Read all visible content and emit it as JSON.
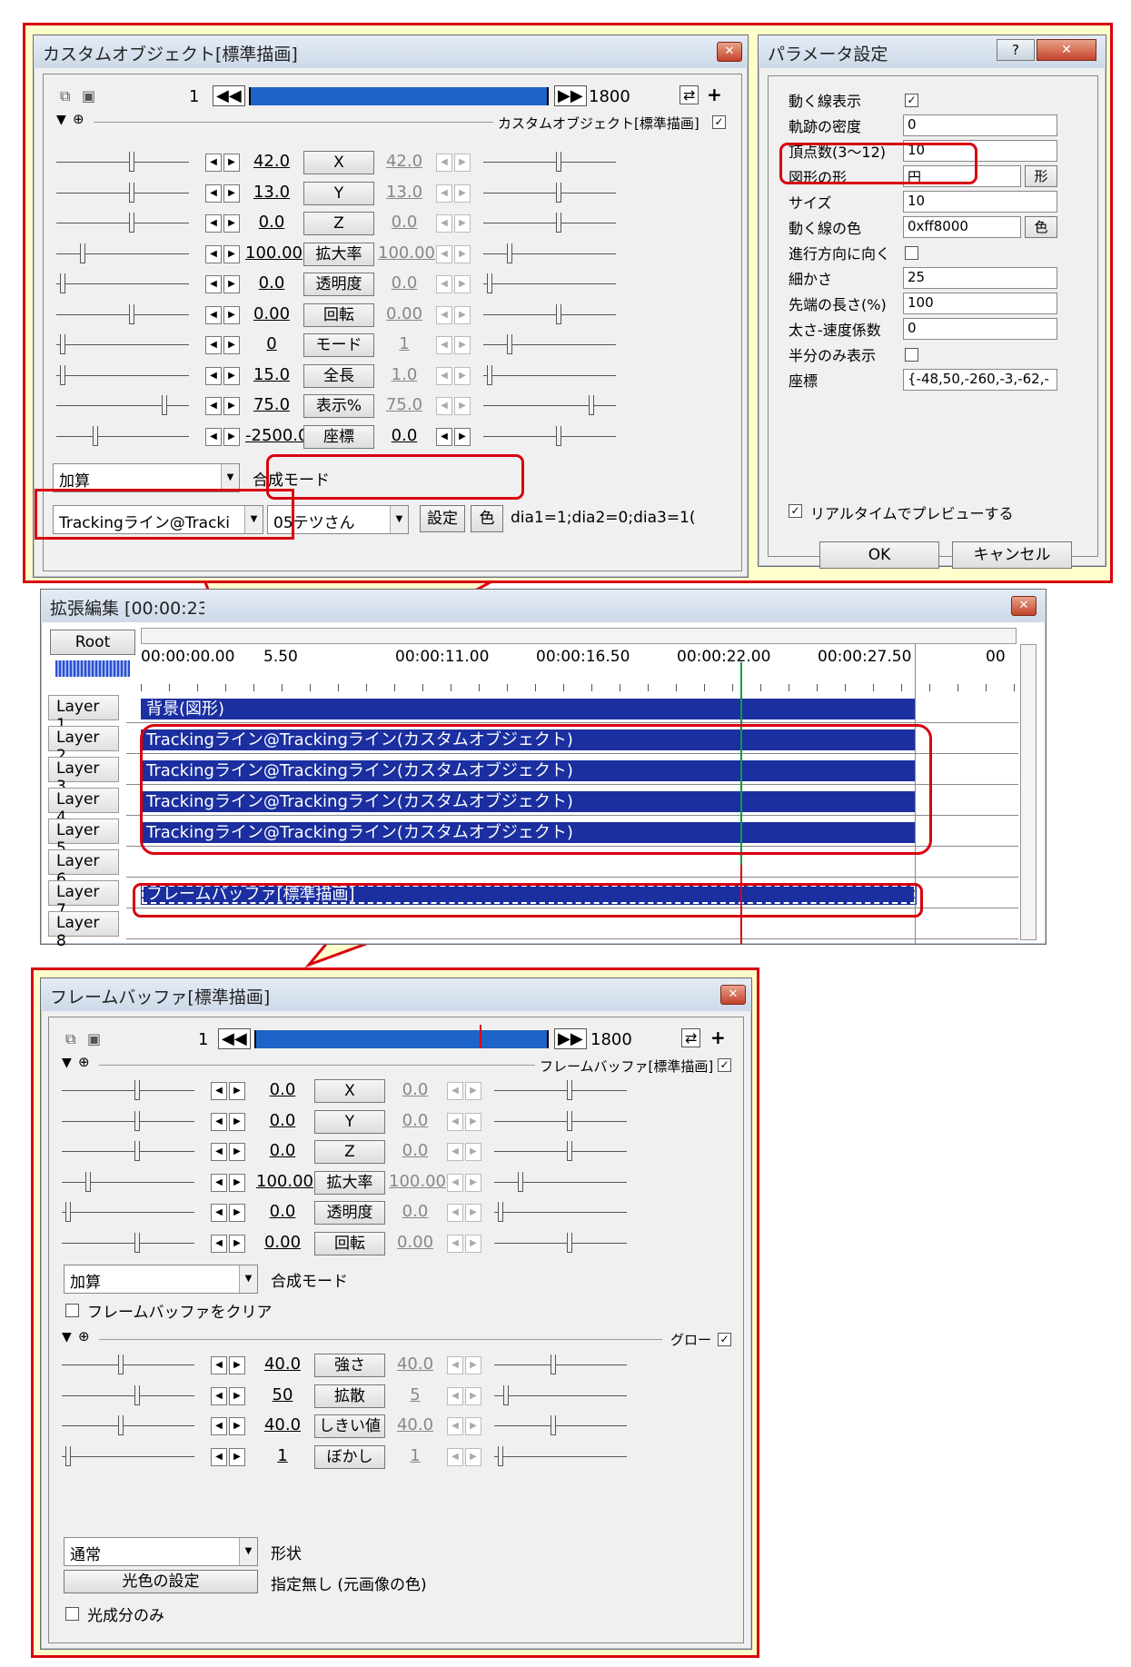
{
  "custom_object": {
    "title": "カスタムオブジェクト[標準描画]",
    "frame_current": "1",
    "frame_total": "1800",
    "plus": "+",
    "group_label": "カスタムオブジェクト[標準描画]",
    "group_checked": "✓",
    "params": [
      {
        "name": "X",
        "start": "42.0",
        "end": "42.0"
      },
      {
        "name": "Y",
        "start": "13.0",
        "end": "13.0"
      },
      {
        "name": "Z",
        "start": "0.0",
        "end": "0.0"
      },
      {
        "name": "拡大率",
        "start": "100.00",
        "end": "100.00"
      },
      {
        "name": "透明度",
        "start": "0.0",
        "end": "0.0"
      },
      {
        "name": "回転",
        "start": "0.00",
        "end": "0.00"
      },
      {
        "name": "モード",
        "start": "0",
        "end": "1"
      },
      {
        "name": "全長",
        "start": "15.0",
        "end": "1.0"
      },
      {
        "name": "表示%",
        "start": "75.0",
        "end": "75.0"
      },
      {
        "name": "座標",
        "start": "-2500.0",
        "end": "0.0"
      }
    ],
    "blend_mode": "加算",
    "blend_label": "合成モード",
    "script_select": "Trackingライン@Tracki",
    "author_select": "05テツさん",
    "settings_button": "設定",
    "color_button": "色",
    "param_text": "dia1=1;dia2=0;dia3=1("
  },
  "param_dialog": {
    "title": "パラメータ設定",
    "help": "?",
    "close": "✕",
    "rows": [
      {
        "label": "動く線表示",
        "type": "check",
        "value": "✓"
      },
      {
        "label": "軌跡の密度",
        "type": "input",
        "value": "0"
      },
      {
        "label": "頂点数(3〜12)",
        "type": "input",
        "value": "10"
      },
      {
        "label": "図形の形",
        "type": "input-btn",
        "value": "円",
        "btn": "形"
      },
      {
        "label": "サイズ",
        "type": "input",
        "value": "10"
      },
      {
        "label": "動く線の色",
        "type": "input-btn",
        "value": "0xff8000",
        "btn": "色"
      },
      {
        "label": "進行方向に向く",
        "type": "check",
        "value": ""
      },
      {
        "label": "細かさ",
        "type": "input",
        "value": "25"
      },
      {
        "label": "先端の長さ(%)",
        "type": "input",
        "value": "100"
      },
      {
        "label": "太さ-速度係数",
        "type": "input",
        "value": "0"
      },
      {
        "label": "半分のみ表示",
        "type": "check",
        "value": ""
      },
      {
        "label": "座標",
        "type": "input",
        "value": "{-48,50,-260,-3,-62,-"
      }
    ],
    "realtime_check": "✓",
    "realtime_label": "リアルタイムでプレビューする",
    "ok": "OK",
    "cancel": "キャンセル"
  },
  "timeline": {
    "title": "拡張編集 [00:00:23",
    "root": "Root",
    "ticks": [
      "00:00:00.00",
      "5.50",
      "00:00:11.00",
      "00:00:16.50",
      "00:00:22.00",
      "00:00:27.50",
      "00"
    ],
    "layers": [
      "Layer 1",
      "Layer 2",
      "Layer 3",
      "Layer 4",
      "Layer 5",
      "Layer 6",
      "Layer 7",
      "Layer 8"
    ],
    "clips": [
      {
        "layer": 0,
        "label": "背景(図形)"
      },
      {
        "layer": 1,
        "label": "Trackingライン@Trackingライン(カスタムオブジェクト)"
      },
      {
        "layer": 2,
        "label": "Trackingライン@Trackingライン(カスタムオブジェクト)"
      },
      {
        "layer": 3,
        "label": "Trackingライン@Trackingライン(カスタムオブジェクト)"
      },
      {
        "layer": 4,
        "label": "Trackingライン@Trackingライン(カスタムオブジェクト)"
      },
      {
        "layer": 6,
        "label": "フレームバッファ[標準描画]"
      }
    ],
    "clip_color": "#1b2fa0"
  },
  "frame_buffer": {
    "title": "フレームバッファ[標準描画]",
    "frame_current": "1",
    "frame_total": "1800",
    "plus": "+",
    "group_label": "フレームバッファ[標準描画]",
    "group_checked": "✓",
    "params": [
      {
        "name": "X",
        "start": "0.0",
        "end": "0.0"
      },
      {
        "name": "Y",
        "start": "0.0",
        "end": "0.0"
      },
      {
        "name": "Z",
        "start": "0.0",
        "end": "0.0"
      },
      {
        "name": "拡大率",
        "start": "100.00",
        "end": "100.00"
      },
      {
        "name": "透明度",
        "start": "0.0",
        "end": "0.0"
      },
      {
        "name": "回転",
        "start": "0.00",
        "end": "0.00"
      }
    ],
    "blend_mode": "加算",
    "blend_label": "合成モード",
    "clear_label": "フレームバッファをクリア",
    "glow_label": "グロー",
    "glow_checked": "✓",
    "glow_params": [
      {
        "name": "強さ",
        "start": "40.0",
        "end": "40.0"
      },
      {
        "name": "拡散",
        "start": "50",
        "end": "5"
      },
      {
        "name": "しきい値",
        "start": "40.0",
        "end": "40.0"
      },
      {
        "name": "ぼかし",
        "start": "1",
        "end": "1"
      }
    ],
    "shape_select": "通常",
    "shape_label": "形状",
    "light_color_button": "光色の設定",
    "light_color_text": "指定無し (元画像の色)",
    "light_only_label": "光成分のみ"
  },
  "colors": {
    "highlight_red": "#d9000f",
    "clip_blue": "#1b2fa0",
    "callout_yellow": "#ffffcc"
  }
}
